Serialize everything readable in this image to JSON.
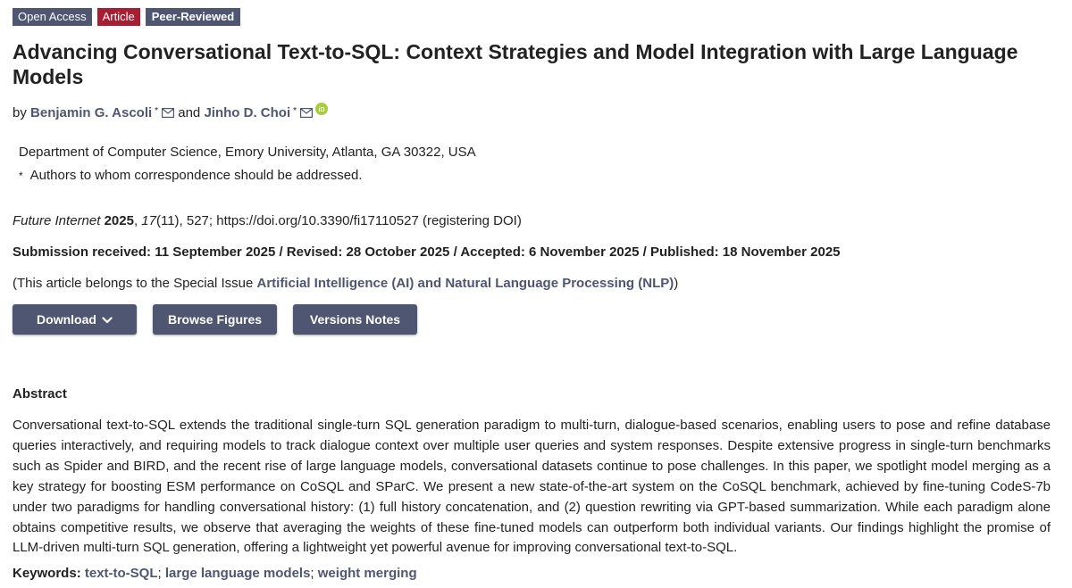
{
  "badges": {
    "open_access": "Open Access",
    "article": "Article",
    "peer_reviewed": "Peer-Reviewed"
  },
  "title": "Advancing Conversational Text-to-SQL: Context Strategies and Model Integration with Large Language Models",
  "authors": {
    "by": "by",
    "and": "and",
    "star": "*",
    "list": [
      {
        "name": "Benjamin G. Ascoli"
      },
      {
        "name": "Jinho D. Choi"
      }
    ]
  },
  "affiliation": "Department of Computer Science, Emory University, Atlanta, GA 30322, USA",
  "correspondence": {
    "star": "*",
    "text": "Authors to whom correspondence should be addressed."
  },
  "citation": {
    "journal": "Future Internet",
    "year": "2025",
    "volume": "17",
    "issue": "(11)",
    "rest": ", 527; https://doi.org/10.3390/fi17110527 (registering DOI)"
  },
  "dates": "Submission received: 11 September 2025 / Revised: 28 October 2025 / Accepted: 6 November 2025 / Published: 18 November 2025",
  "special_issue": {
    "prefix": "(This article belongs to the Special Issue ",
    "link": "Artificial Intelligence (AI) and Natural Language Processing (NLP)",
    "suffix": ")"
  },
  "buttons": {
    "download": "Download",
    "browse_figures": "Browse Figures",
    "versions_notes": "Versions Notes"
  },
  "abstract": {
    "heading": "Abstract",
    "text": "Conversational text-to-SQL extends the traditional single-turn SQL generation paradigm to multi-turn, dialogue-based scenarios, enabling users to pose and refine database queries interactively, and requiring models to track dialogue context over multiple user queries and system responses. Despite extensive progress in single-turn benchmarks such as Spider and BIRD, and the recent rise of large language models, conversational datasets continue to pose challenges. In this paper, we spotlight model merging as a key strategy for boosting ESM performance on CoSQL and SParC. We present a new state-of-the-art system on the CoSQL benchmark, achieved by fine-tuning CodeS-7b under two paradigms for handling conversational history: (1) full history concatenation, and (2) question rewriting via GPT-based summarization. While each paradigm alone obtains competitive results, we observe that averaging the weights of these fine-tuned models can outperform both individual variants. Our findings highlight the promise of LLM-driven multi-turn SQL generation, offering a lightweight yet powerful avenue for improving conversational text-to-SQL."
  },
  "keywords": {
    "label": "Keywords:",
    "items": [
      "text-to-SQL",
      "large language models",
      "weight merging"
    ],
    "separator": ";"
  },
  "icons": {
    "mail": "envelope-icon",
    "orcid": "orcid-icon",
    "chevron": "chevron-down-icon"
  },
  "colors": {
    "primary": "#4f5671",
    "article": "#a71d31",
    "orcid": "#a6ce39"
  }
}
